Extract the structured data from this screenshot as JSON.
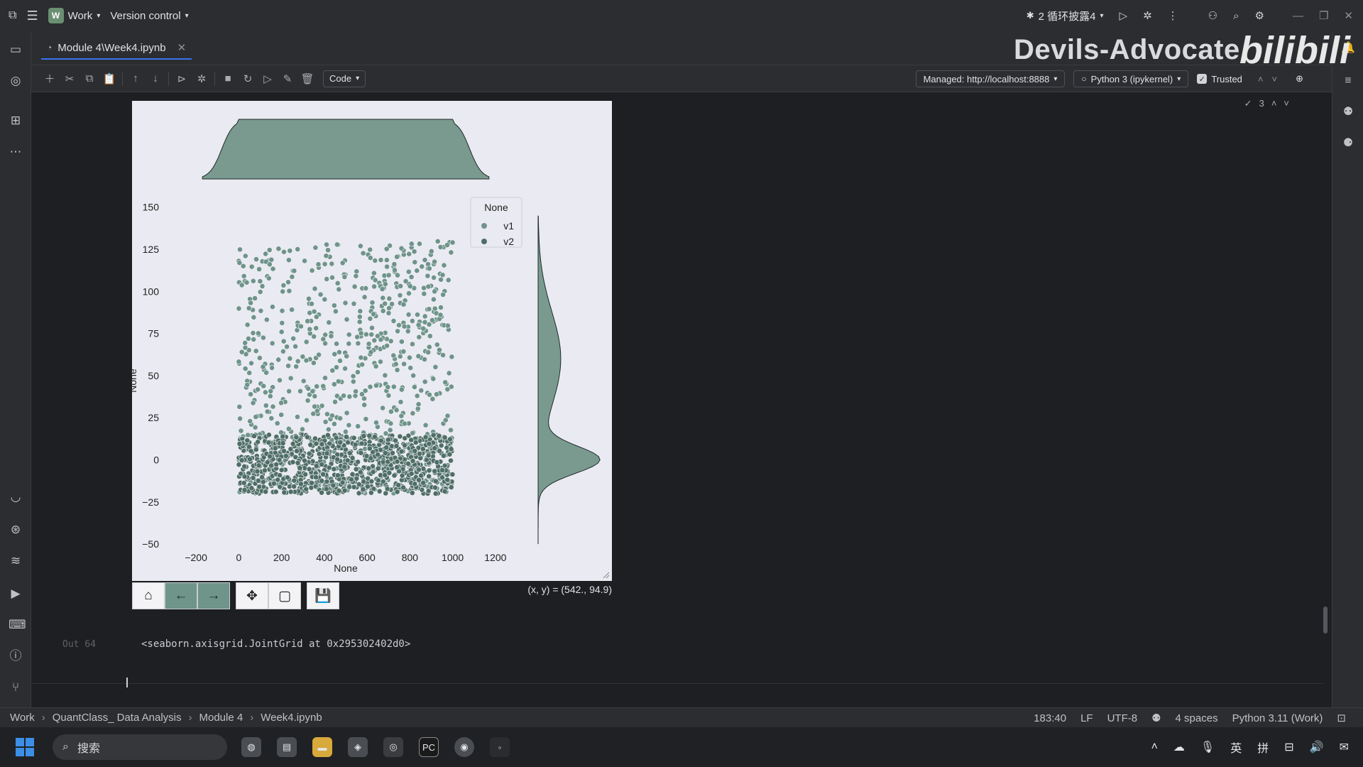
{
  "titlebar": {
    "project_badge": "W",
    "project": "Work",
    "vcs": "Version control",
    "run_config": "2 循环披露4"
  },
  "tab": {
    "label": "Module 4\\Week4.ipynb"
  },
  "watermark": {
    "text": "Devils-Advocate",
    "logo": "bilibili"
  },
  "toolbar": {
    "cell_type": "Code",
    "server": "Managed: http://localhost:8888",
    "kernel": "Python 3 (ipykernel)",
    "trusted": "Trusted",
    "check_count": "3"
  },
  "figure": {
    "legend_title": "None",
    "x_label": "None",
    "y_label": "None",
    "coord_readout": "(x, y) = (542., 94.9)"
  },
  "chart_data": {
    "type": "scatter",
    "xlim": [
      -300,
      1300
    ],
    "ylim": [
      -55,
      160
    ],
    "xticks": [
      "−200",
      "0",
      "200",
      "400",
      "600",
      "800",
      "1000",
      "1200"
    ],
    "xtick_values": [
      -200,
      0,
      200,
      400,
      600,
      800,
      1000,
      1200
    ],
    "yticks": [
      "150",
      "125",
      "100",
      "75",
      "50",
      "25",
      "0",
      "−25",
      "−50"
    ],
    "ytick_values": [
      150,
      125,
      100,
      75,
      50,
      25,
      0,
      -25,
      -50
    ],
    "xlabel": "None",
    "ylabel": "None",
    "legend_title": "None",
    "legend_position": "upper-right",
    "series": [
      {
        "name": "v1",
        "color": "#6f948a",
        "x_range": [
          0,
          1000
        ],
        "y_range": [
          -20,
          130
        ]
      },
      {
        "name": "v2",
        "color": "#4f6e66",
        "x_range": [
          0,
          1000
        ],
        "y_range": [
          -20,
          15
        ]
      }
    ],
    "marginal_x": "kde",
    "marginal_y": "kde",
    "grid": false
  },
  "output": {
    "label": "Out 64",
    "text": "<seaborn.axisgrid.JointGrid at 0x295302402d0>"
  },
  "statusbar": {
    "crumbs": [
      "Work",
      "QuantClass_ Data Analysis",
      "Module 4",
      "Week4.ipynb"
    ],
    "position": "183:40",
    "line_sep": "LF",
    "encoding": "UTF-8",
    "indent": "4 spaces",
    "interpreter": "Python 3.11 (Work)"
  },
  "taskbar": {
    "search_placeholder": "搜索",
    "ime_lang": "英",
    "ime_mode": "拼"
  },
  "colors": {
    "accent": "#3574f0",
    "scatter": "#6f948a",
    "figure_bg": "#eaeaf2"
  }
}
